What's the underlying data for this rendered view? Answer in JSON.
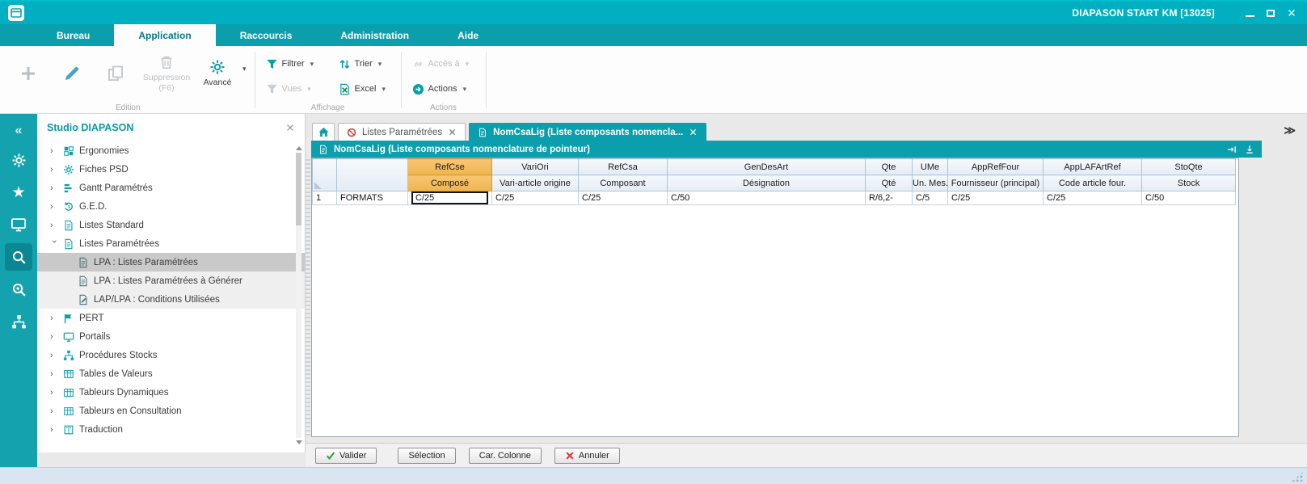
{
  "window": {
    "title": "DIAPASON START KM [13025]"
  },
  "menubar": {
    "tabs": [
      {
        "label": "Bureau"
      },
      {
        "label": "Application"
      },
      {
        "label": "Raccourcis"
      },
      {
        "label": "Administration"
      },
      {
        "label": "Aide"
      }
    ]
  },
  "ribbon": {
    "suppression_line1": "Suppression",
    "suppression_line2": "(F6)",
    "avance": "Avancé",
    "filtrer": "Filtrer",
    "trier": "Trier",
    "acces": "Accès à",
    "vues": "Vues",
    "excel": "Excel",
    "actions": "Actions",
    "group_edition": "Edition",
    "group_affichage": "Affichage",
    "group_actions": "Actions"
  },
  "sidebar": {
    "title": "Studio DIAPASON",
    "items": [
      {
        "label": "Ergonomies"
      },
      {
        "label": "Fiches PSD"
      },
      {
        "label": "Gantt Paramétrés"
      },
      {
        "label": "G.E.D."
      },
      {
        "label": "Listes Standard"
      },
      {
        "label": "Listes Paramétrées"
      },
      {
        "label": "LPA : Listes Paramétrées"
      },
      {
        "label": "LPA : Listes Paramétrées à Générer"
      },
      {
        "label": "LAP/LPA : Conditions Utilisées"
      },
      {
        "label": "PERT"
      },
      {
        "label": "Portails"
      },
      {
        "label": "Procédures Stocks"
      },
      {
        "label": "Tables de Valeurs"
      },
      {
        "label": "Tableurs Dynamiques"
      },
      {
        "label": "Tableurs en Consultation"
      },
      {
        "label": "Traduction"
      }
    ]
  },
  "tabs": {
    "tab1": "Listes Paramétrées",
    "tab2": "NomCsaLig (Liste composants nomencla..."
  },
  "panel": {
    "title": "NomCsaLig (Liste composants nomenclature de pointeur)"
  },
  "grid": {
    "headers": [
      {
        "code": "RefCse",
        "label": "Composé"
      },
      {
        "code": "VariOri",
        "label": "Vari-article origine"
      },
      {
        "code": "RefCsa",
        "label": "Composant"
      },
      {
        "code": "GenDesArt",
        "label": "Désignation"
      },
      {
        "code": "Qte",
        "label": "Qté"
      },
      {
        "code": "UMe",
        "label": "Un. Mes."
      },
      {
        "code": "AppRefFour",
        "label": "Fournisseur (principal)"
      },
      {
        "code": "AppLAFArtRef",
        "label": "Code article four."
      },
      {
        "code": "StoQte",
        "label": "Stock"
      }
    ],
    "row": {
      "num": "1",
      "name": "FORMATS",
      "refcse": "C/25",
      "variori": "C/25",
      "refcsa": "C/25",
      "gendesart": "C/50",
      "qte": "R/6,2-",
      "ume": "C/5",
      "apprefour": "C/25",
      "applafartref": "C/25",
      "stoqte": "C/50"
    }
  },
  "footer": {
    "valider": "Valider",
    "selection": "Sélection",
    "car_colonne": "Car. Colonne",
    "annuler": "Annuler"
  }
}
